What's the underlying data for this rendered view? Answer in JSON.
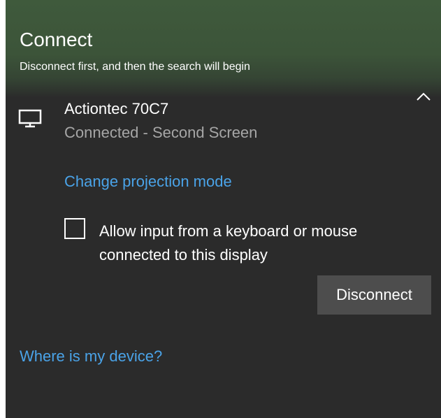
{
  "header": {
    "title": "Connect",
    "subtitle": "Disconnect first, and then the search will begin",
    "collapse_icon": "chevron-up-icon"
  },
  "device": {
    "icon": "monitor-icon",
    "name": "Actiontec 70C7",
    "status": "Connected - Second Screen",
    "projection_link": "Change projection mode",
    "allow_input": {
      "checked": false,
      "label": "Allow input from a keyboard or mouse connected to this display"
    },
    "disconnect_label": "Disconnect"
  },
  "footer": {
    "where_link": "Where is my device?"
  },
  "colors": {
    "panel_bg": "#2b2b2b",
    "header_bg": "#3c5439",
    "link": "#4aa3e8",
    "status_text": "#a6a6a6",
    "button_bg": "#4d4d4d"
  }
}
